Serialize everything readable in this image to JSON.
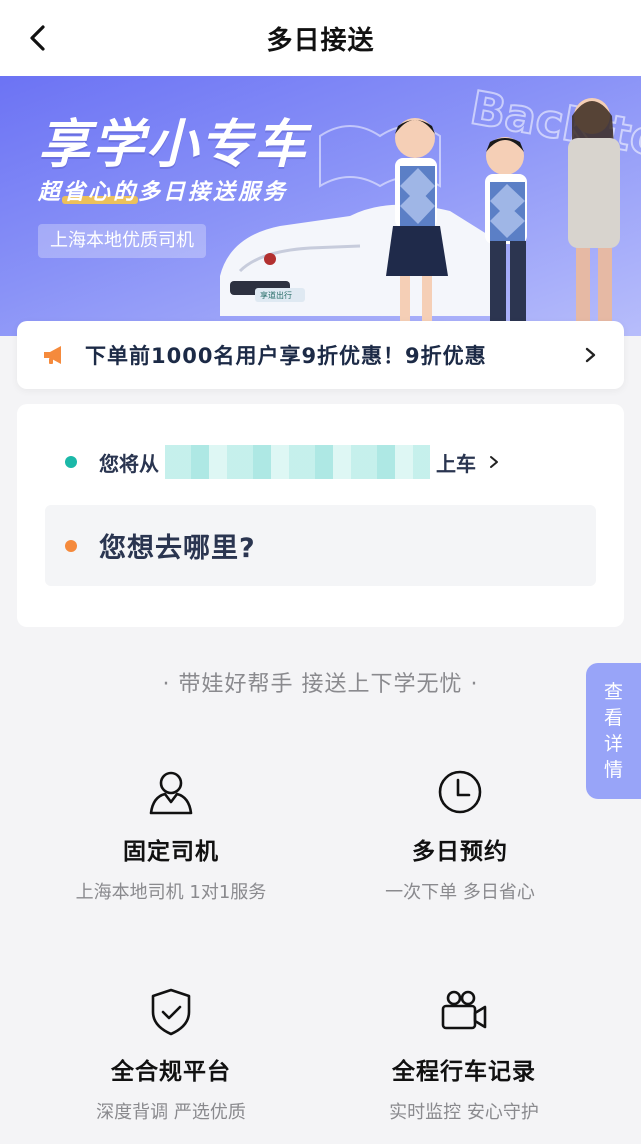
{
  "header": {
    "title": "多日接送"
  },
  "banner": {
    "title": "享学小专车",
    "subtitle": "超省心的多日接送服务",
    "tag": "上海本地优质司机",
    "bg_text": "Back to School",
    "car_plate": "享道出行"
  },
  "promo": {
    "text": "下单前1000名用户享9折优惠！9折优惠",
    "icon": "megaphone-icon"
  },
  "location": {
    "from_prefix": "您将从",
    "from_suffix": "上车",
    "to_placeholder": "您想去哪里?"
  },
  "slogan": "· 带娃好帮手 接送上下学无忧 ·",
  "side_tab": {
    "chars": [
      "查",
      "看",
      "详",
      "情"
    ]
  },
  "features": [
    {
      "title": "固定司机",
      "desc": "上海本地司机  1对1服务",
      "icon": "driver-icon"
    },
    {
      "title": "多日预约",
      "desc": "一次下单  多日省心",
      "icon": "clock-icon"
    },
    {
      "title": "全合规平台",
      "desc": "深度背调  严选优质",
      "icon": "shield-check-icon"
    },
    {
      "title": "全程行车记录",
      "desc": "实时监控  安心守护",
      "icon": "video-camera-icon"
    }
  ],
  "colors": {
    "banner_start": "#6c73f4",
    "from_dot": "#1bb8a8",
    "to_dot": "#f58a3c",
    "promo_icon": "#f58a3c",
    "side_tab": "#98a4f8"
  }
}
